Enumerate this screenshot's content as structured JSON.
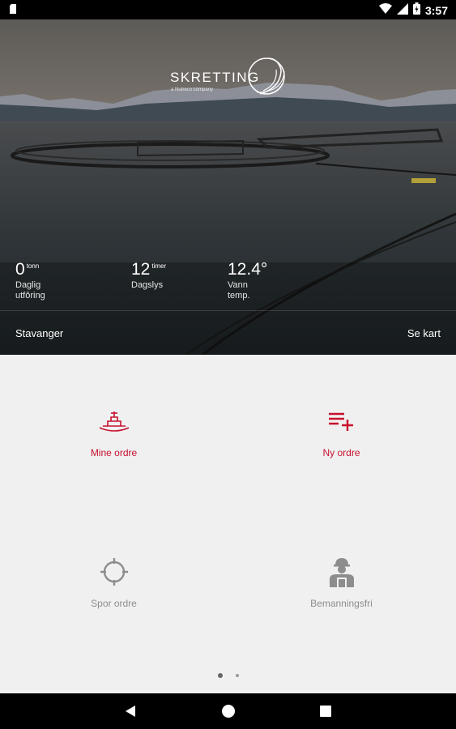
{
  "status_bar": {
    "time": "3:57"
  },
  "hero": {
    "brand": "SKRETTING",
    "brand_sub": "a Nutreco company",
    "stats": [
      {
        "value": "0",
        "unit": "tonn",
        "label_1": "Daglig",
        "label_2": "utfôring"
      },
      {
        "value": "12",
        "unit": "timer",
        "label_1": "Dagslys",
        "label_2": ""
      },
      {
        "value": "12.4°",
        "unit": "",
        "label_1": "Vann",
        "label_2": "temp."
      }
    ],
    "location": "Stavanger",
    "see_map": "Se kart"
  },
  "menu": {
    "items": [
      {
        "label": "Mine ordre",
        "icon": "boat-icon",
        "color": "#c8102e"
      },
      {
        "label": "Ny ordre",
        "icon": "add-list-icon",
        "color": "#c8102e"
      },
      {
        "label": "Spor ordre",
        "icon": "crosshair-icon",
        "color": "#8d8d8d"
      },
      {
        "label": "Bemanningsfri",
        "icon": "worker-icon",
        "color": "#8d8d8d"
      }
    ],
    "page_count": 2,
    "current_page": 1
  },
  "colors": {
    "accent": "#c8102e",
    "inactive": "#8d8d8d",
    "background": "#f0f0f0"
  }
}
